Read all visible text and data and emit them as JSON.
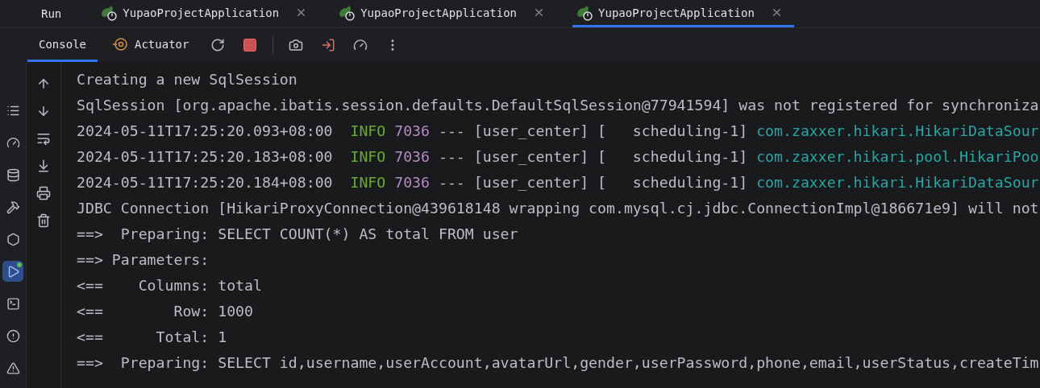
{
  "run_panel": {
    "title": "Run",
    "tabs": [
      {
        "label": "YupaoProjectApplication",
        "selected": false
      },
      {
        "label": "YupaoProjectApplication",
        "selected": false
      },
      {
        "label": "YupaoProjectApplication",
        "selected": true
      }
    ]
  },
  "toolbar": {
    "tabs": [
      {
        "label": "Console",
        "selected": true
      },
      {
        "label": "Actuator",
        "selected": false
      }
    ]
  },
  "tool_strip": [
    {
      "kind": "structure",
      "selected": false
    },
    {
      "kind": "gauge",
      "selected": false
    },
    {
      "kind": "database",
      "selected": false
    },
    {
      "kind": "build",
      "selected": false
    },
    {
      "kind": "services",
      "selected": false
    },
    {
      "kind": "run",
      "selected": true
    },
    {
      "kind": "terminal",
      "selected": false
    },
    {
      "kind": "problems",
      "selected": false
    },
    {
      "kind": "warning",
      "selected": false
    }
  ],
  "console": {
    "lines": [
      [
        {
          "kind": "plain",
          "text": "Creating a new SqlSession"
        }
      ],
      [
        {
          "kind": "plain",
          "text": "SqlSession [org.apache.ibatis.session.defaults.DefaultSqlSession@77941594] was not registered for synchroniza"
        }
      ],
      [
        {
          "kind": "plain",
          "text": "2024-05-11T17:25:20.093+08:00  "
        },
        {
          "kind": "level",
          "text": "INFO"
        },
        {
          "kind": "pid",
          "text": " 7036"
        },
        {
          "kind": "plain",
          "text": " --- [user_center] [   scheduling-1] "
        },
        {
          "kind": "logger",
          "text": "com.zaxxer.hikari.HikariDataSour"
        }
      ],
      [
        {
          "kind": "plain",
          "text": "2024-05-11T17:25:20.183+08:00  "
        },
        {
          "kind": "level",
          "text": "INFO"
        },
        {
          "kind": "pid",
          "text": " 7036"
        },
        {
          "kind": "plain",
          "text": " --- [user_center] [   scheduling-1] "
        },
        {
          "kind": "logger",
          "text": "com.zaxxer.hikari.pool.HikariPoo"
        }
      ],
      [
        {
          "kind": "plain",
          "text": "2024-05-11T17:25:20.184+08:00  "
        },
        {
          "kind": "level",
          "text": "INFO"
        },
        {
          "kind": "pid",
          "text": " 7036"
        },
        {
          "kind": "plain",
          "text": " --- [user_center] [   scheduling-1] "
        },
        {
          "kind": "logger",
          "text": "com.zaxxer.hikari.HikariDataSour"
        }
      ],
      [
        {
          "kind": "plain",
          "text": "JDBC Connection [HikariProxyConnection@439618148 wrapping com.mysql.cj.jdbc.ConnectionImpl@186671e9] will not"
        }
      ],
      [
        {
          "kind": "plain",
          "text": "==>  Preparing: SELECT COUNT(*) AS total FROM user"
        }
      ],
      [
        {
          "kind": "plain",
          "text": "==> Parameters:"
        }
      ],
      [
        {
          "kind": "plain",
          "text": "<==    Columns: total"
        }
      ],
      [
        {
          "kind": "plain",
          "text": "<==        Row: 1000"
        }
      ],
      [
        {
          "kind": "plain",
          "text": "<==      Total: 1"
        }
      ],
      [
        {
          "kind": "plain",
          "text": "==>  Preparing: SELECT id,username,userAccount,avatarUrl,gender,userPassword,phone,email,userStatus,createTim"
        }
      ]
    ]
  }
}
